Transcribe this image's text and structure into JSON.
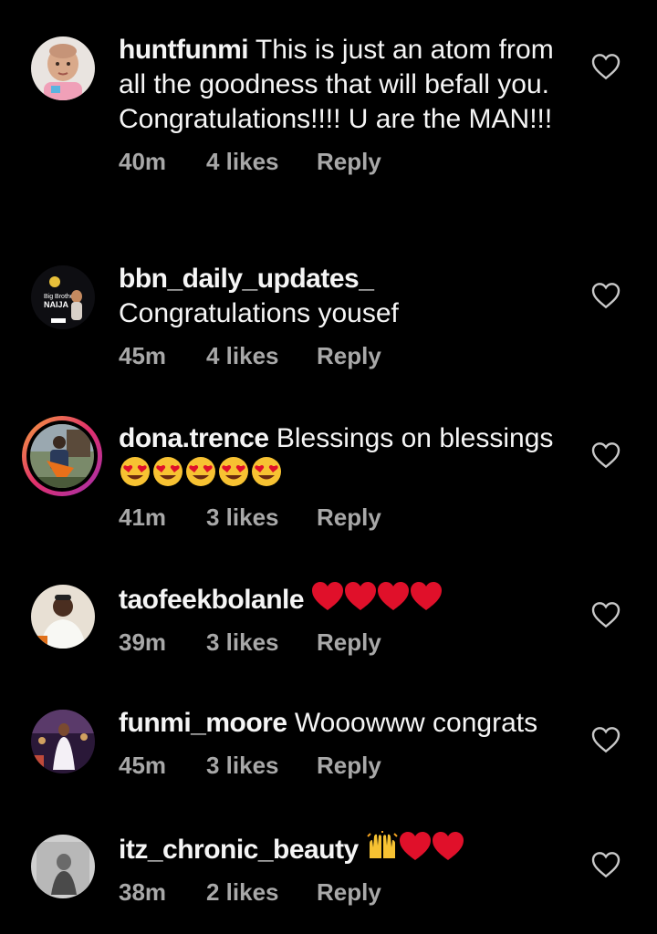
{
  "comments": [
    {
      "username": "huntfunmi",
      "text": " This is just an atom from all the goodness that will befall you. Congratulations!!!! U are the MAN!!!",
      "emoji": [],
      "time": "40m",
      "likes": "4 likes",
      "reply": "Reply"
    },
    {
      "username": "bbn_daily_updates_",
      "text": " Congratulations yousef",
      "emoji": [],
      "time": "45m",
      "likes": "4 likes",
      "reply": "Reply"
    },
    {
      "username": "dona.trence",
      "text": " Blessings on blessings ",
      "emoji": [
        "heart-eyes-emoji",
        "heart-eyes-emoji",
        "heart-eyes-emoji",
        "heart-eyes-emoji",
        "heart-eyes-emoji"
      ],
      "time": "41m",
      "likes": "3 likes",
      "reply": "Reply"
    },
    {
      "username": "taofeekbolanle",
      "text": " ",
      "emoji": [
        "red-heart-emoji",
        "red-heart-emoji",
        "red-heart-emoji",
        "red-heart-emoji"
      ],
      "time": "39m",
      "likes": "3 likes",
      "reply": "Reply"
    },
    {
      "username": "funmi_moore",
      "text": " Wooowww congrats",
      "emoji": [],
      "time": "45m",
      "likes": "3 likes",
      "reply": "Reply"
    },
    {
      "username": "itz_chronic_beauty",
      "text": " ",
      "emoji": [
        "raising-hands-emoji",
        "red-heart-emoji",
        "red-heart-emoji"
      ],
      "time": "38m",
      "likes": "2 likes",
      "reply": "Reply"
    }
  ],
  "icons": {
    "like": "heart-outline-icon"
  },
  "colors": {
    "background": "#000000",
    "text": "#f5f5f5",
    "meta": "#a8a8a8",
    "story_ring_start": "#f6a23c",
    "story_ring_end": "#a12fb0",
    "heart_red": "#e0102a"
  }
}
